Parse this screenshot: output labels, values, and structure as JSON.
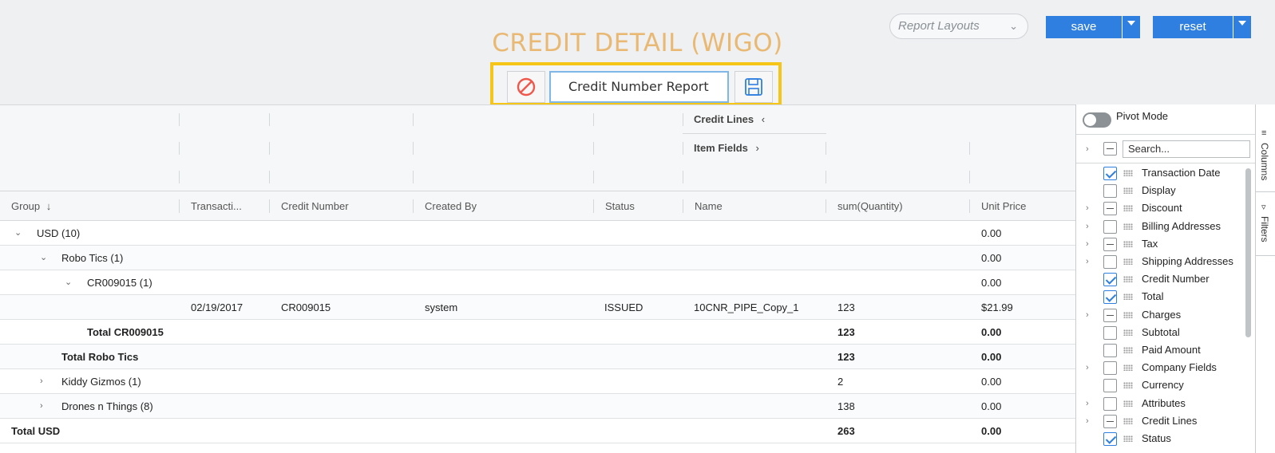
{
  "header": {
    "title": "CREDIT DETAIL (WIGO)",
    "report_name_value": "Credit Number Report",
    "layouts_placeholder": "Report Layouts",
    "save_label": "save",
    "reset_label": "reset",
    "title_color": "#e9b872",
    "accent": "#2f7fe0"
  },
  "group_header": {
    "credit_lines": "Credit Lines",
    "item_fields": "Item Fields"
  },
  "columns": [
    "Group",
    "Transacti...",
    "Credit Number",
    "Created By",
    "Status",
    "Name",
    "sum(Quantity)",
    "Unit Price"
  ],
  "rows": [
    {
      "label": "USD (10)",
      "qty": "",
      "price": "0.00"
    },
    {
      "label": "Robo Tics (1)",
      "qty": "",
      "price": "0.00"
    },
    {
      "label": "CR009015 (1)",
      "qty": "",
      "price": "0.00"
    },
    {
      "label": "",
      "date": "02/19/2017",
      "credit": "CR009015",
      "by": "system",
      "status": "ISSUED",
      "name": "10CNR_PIPE_Copy_1",
      "qty": "123",
      "price": "$21.99"
    },
    {
      "label": "Total CR009015",
      "qty": "123",
      "price": "0.00"
    },
    {
      "label": "Total Robo Tics",
      "qty": "123",
      "price": "0.00"
    },
    {
      "label": "Kiddy Gizmos (1)",
      "qty": "2",
      "price": "0.00"
    },
    {
      "label": "Drones n Things (8)",
      "qty": "138",
      "price": "0.00"
    },
    {
      "label": "Total USD",
      "qty": "263",
      "price": "0.00"
    }
  ],
  "side_panel": {
    "pivot_label": "Pivot Mode",
    "search_placeholder": "Search...",
    "items": [
      {
        "label": "Transaction Date",
        "state": "checked",
        "expandable": false
      },
      {
        "label": "Display",
        "state": "unchecked",
        "expandable": false
      },
      {
        "label": "Discount",
        "state": "partial",
        "expandable": true
      },
      {
        "label": "Billing Addresses",
        "state": "unchecked",
        "expandable": true
      },
      {
        "label": "Tax",
        "state": "partial",
        "expandable": true
      },
      {
        "label": "Shipping Addresses",
        "state": "unchecked",
        "expandable": true
      },
      {
        "label": "Credit Number",
        "state": "checked",
        "expandable": false
      },
      {
        "label": "Total",
        "state": "checked",
        "expandable": false
      },
      {
        "label": "Charges",
        "state": "partial",
        "expandable": true
      },
      {
        "label": "Subtotal",
        "state": "unchecked",
        "expandable": false
      },
      {
        "label": "Paid Amount",
        "state": "unchecked",
        "expandable": false
      },
      {
        "label": "Company Fields",
        "state": "unchecked",
        "expandable": true
      },
      {
        "label": "Currency",
        "state": "unchecked",
        "expandable": false
      },
      {
        "label": "Attributes",
        "state": "unchecked",
        "expandable": true
      },
      {
        "label": "Credit Lines",
        "state": "partial",
        "expandable": true
      },
      {
        "label": "Status",
        "state": "checked",
        "expandable": false
      }
    ]
  },
  "tabs": {
    "columns": "Columns",
    "filters": "Filters"
  }
}
